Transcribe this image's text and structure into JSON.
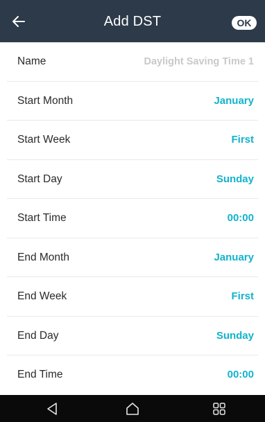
{
  "header": {
    "title": "Add DST",
    "ok_label": "OK",
    "back_icon": "arrow-left-icon",
    "background": "#2d3a4a"
  },
  "form": {
    "rows": [
      {
        "label": "Name",
        "value": "Daylight Saving Time 1",
        "is_placeholder": true
      },
      {
        "label": "Start Month",
        "value": "January"
      },
      {
        "label": "Start Week",
        "value": "First"
      },
      {
        "label": "Start Day",
        "value": "Sunday"
      },
      {
        "label": "Start Time",
        "value": "00:00"
      },
      {
        "label": "End Month",
        "value": "January"
      },
      {
        "label": "End Week",
        "value": "First"
      },
      {
        "label": "End Day",
        "value": "Sunday"
      },
      {
        "label": "End Time",
        "value": "00:00"
      }
    ]
  },
  "colors": {
    "accent": "#12b3cc",
    "placeholder": "#c9c9c9",
    "navbar": "#0a0a0a"
  },
  "navbar": {
    "icons": [
      "triangle-back-icon",
      "home-icon",
      "recent-apps-icon"
    ]
  }
}
